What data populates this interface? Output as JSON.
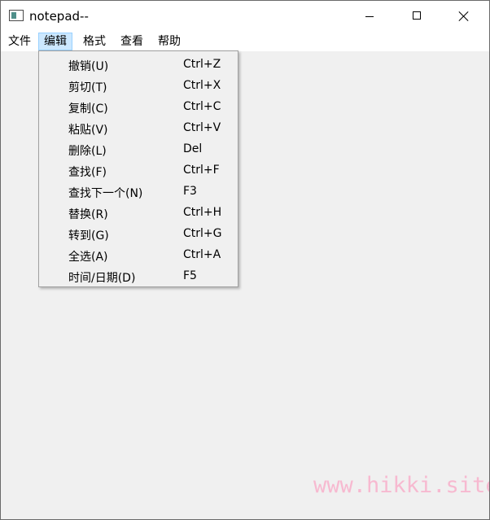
{
  "window": {
    "title": "notepad--",
    "controls": {
      "minimize": "minimize-icon",
      "maximize": "maximize-icon",
      "close": "close-icon"
    }
  },
  "menubar": {
    "items": [
      {
        "label": "文件"
      },
      {
        "label": "编辑",
        "active": true
      },
      {
        "label": "格式"
      },
      {
        "label": "查看"
      },
      {
        "label": "帮助"
      }
    ]
  },
  "edit_menu": {
    "items": [
      {
        "label": "撤销(U)",
        "shortcut": "Ctrl+Z"
      },
      {
        "label": "剪切(T)",
        "shortcut": "Ctrl+X"
      },
      {
        "label": "复制(C)",
        "shortcut": "Ctrl+C"
      },
      {
        "label": "粘贴(V)",
        "shortcut": "Ctrl+V"
      },
      {
        "label": "删除(L)",
        "shortcut": "Del"
      },
      {
        "label": "查找(F)",
        "shortcut": "Ctrl+F"
      },
      {
        "label": "查找下一个(N)",
        "shortcut": "F3"
      },
      {
        "label": "替换(R)",
        "shortcut": "Ctrl+H"
      },
      {
        "label": "转到(G)",
        "shortcut": "Ctrl+G"
      },
      {
        "label": "全选(A)",
        "shortcut": "Ctrl+A"
      },
      {
        "label": "时间/日期(D)",
        "shortcut": "F5"
      }
    ]
  },
  "watermark": "www.hikki.site",
  "colors": {
    "menu_highlight": "#cce8ff",
    "menu_highlight_border": "#99d1ff",
    "watermark": "#f7b9d0",
    "client_background": "#f0f0f0"
  }
}
